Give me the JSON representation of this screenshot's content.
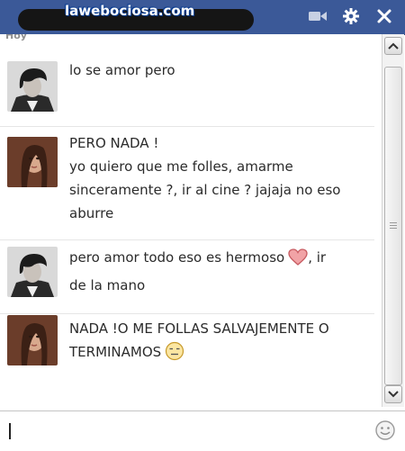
{
  "watermark": "lawebociosa.com",
  "titlebar": {
    "icons": [
      "video-camera-icon",
      "gear-icon",
      "close-icon"
    ]
  },
  "chat": {
    "day_label": "Hoy",
    "messages": [
      {
        "sender": "him",
        "avatar": "avatar-dark-hair-boy",
        "lines": [
          "lo se amor pero"
        ]
      },
      {
        "sender": "her",
        "avatar": "avatar-girl",
        "lines": [
          "PERO NADA !",
          "yo quiero que me folles, amarme",
          "sinceramente ?, ir al cine ? jajaja no eso",
          "aburre"
        ]
      },
      {
        "sender": "him",
        "avatar": "avatar-dark-hair-boy",
        "lines": [
          "pero amor todo eso es hermoso",
          ", ir",
          "de la mano"
        ],
        "emoticon": "heart-icon"
      },
      {
        "sender": "her",
        "avatar": "avatar-girl",
        "lines": [
          "NADA !O ME FOLLAS SALVAJEMENTE O",
          "TERMINAMOS"
        ],
        "emoticon": "unamused-face-icon"
      }
    ]
  },
  "input": {
    "value": "",
    "placeholder": ""
  },
  "colors": {
    "titlebar": "#3b5998",
    "text": "#2b2b2b",
    "heart": "#d9656a"
  }
}
